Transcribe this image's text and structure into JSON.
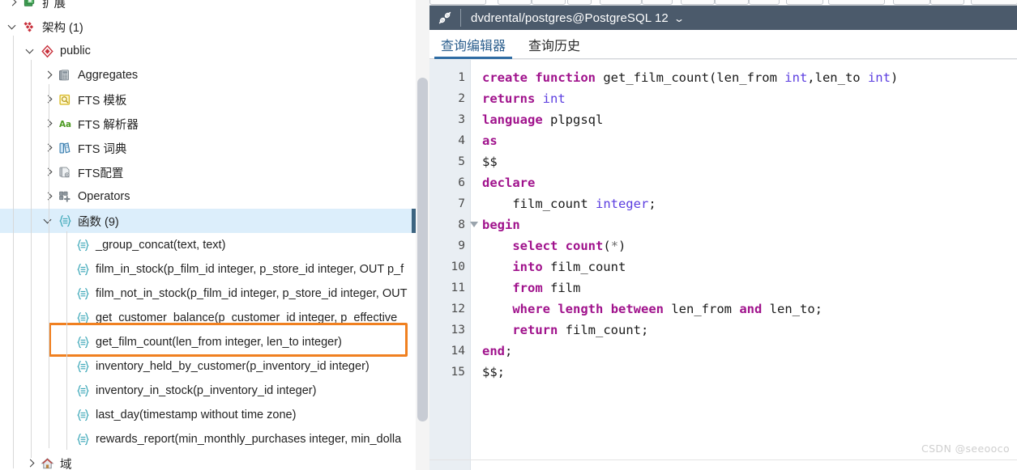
{
  "sidebar": {
    "scrollbar": {
      "name": "vertical-scrollbar"
    },
    "tree": [
      {
        "label": "扩展",
        "icon": "extensions-icon",
        "indent": 0,
        "arrow": "right",
        "selected": false,
        "clipped": true
      },
      {
        "label": "架构 (1)",
        "icon": "schemas-icon",
        "indent": 0,
        "arrow": "down",
        "selected": false
      },
      {
        "label": "public",
        "icon": "schema-icon",
        "indent": 1,
        "arrow": "down",
        "selected": false
      },
      {
        "label": "Aggregates",
        "icon": "aggregates-icon",
        "indent": 2,
        "arrow": "right",
        "selected": false
      },
      {
        "label": "FTS 模板",
        "icon": "fts-template-icon",
        "indent": 2,
        "arrow": "right",
        "selected": false
      },
      {
        "label": "FTS 解析器",
        "icon": "fts-parser-icon",
        "indent": 2,
        "arrow": "right",
        "selected": false
      },
      {
        "label": "FTS 词典",
        "icon": "fts-dictionary-icon",
        "indent": 2,
        "arrow": "right",
        "selected": false
      },
      {
        "label": "FTS配置",
        "icon": "fts-configuration-icon",
        "indent": 2,
        "arrow": "right",
        "selected": false
      },
      {
        "label": "Operators",
        "icon": "operators-icon",
        "indent": 2,
        "arrow": "right",
        "selected": false
      },
      {
        "label": "函数 (9)",
        "icon": "functions-icon",
        "indent": 2,
        "arrow": "down",
        "selected": true
      },
      {
        "label": "_group_concat(text, text)",
        "icon": "function-icon",
        "indent": 3,
        "arrow": "none",
        "selected": false
      },
      {
        "label": "film_in_stock(p_film_id integer, p_store_id integer, OUT p_f",
        "icon": "function-icon",
        "indent": 3,
        "arrow": "none",
        "selected": false
      },
      {
        "label": "film_not_in_stock(p_film_id integer, p_store_id integer, OUT",
        "icon": "function-icon",
        "indent": 3,
        "arrow": "none",
        "selected": false
      },
      {
        "label": "get_customer_balance(p_customer_id integer, p_effective",
        "icon": "function-icon",
        "indent": 3,
        "arrow": "none",
        "selected": false
      },
      {
        "label": "get_film_count(len_from integer, len_to integer)",
        "icon": "function-icon",
        "indent": 3,
        "arrow": "none",
        "selected": false,
        "highlighted": true
      },
      {
        "label": "inventory_held_by_customer(p_inventory_id integer)",
        "icon": "function-icon",
        "indent": 3,
        "arrow": "none",
        "selected": false
      },
      {
        "label": "inventory_in_stock(p_inventory_id integer)",
        "icon": "function-icon",
        "indent": 3,
        "arrow": "none",
        "selected": false
      },
      {
        "label": "last_day(timestamp without time zone)",
        "icon": "function-icon",
        "indent": 3,
        "arrow": "none",
        "selected": false
      },
      {
        "label": "rewards_report(min_monthly_purchases integer, min_dolla",
        "icon": "function-icon",
        "indent": 3,
        "arrow": "none",
        "selected": false
      },
      {
        "label": "域",
        "icon": "domains-icon",
        "indent": 1,
        "arrow": "right",
        "selected": false
      }
    ],
    "highlight_color": "#f08020"
  },
  "query_tool": {
    "connection_title": "dvdrental/postgres@PostgreSQL 12",
    "connection_caret": "⌄",
    "titlebar_icon": "connection-icon",
    "titlebar_color": "#4b5a6b",
    "tabs": [
      {
        "label": "查询编辑器",
        "active": true
      },
      {
        "label": "查询历史",
        "active": false
      }
    ],
    "accent_color": "#2f6ca3",
    "editor": {
      "line_numbers": [
        "1",
        "2",
        "3",
        "4",
        "5",
        "6",
        "7",
        "8",
        "9",
        "10",
        "11",
        "12",
        "13",
        "14",
        "15"
      ],
      "fold_marker_line": 8,
      "lines": [
        {
          "n": 1,
          "tokens": [
            {
              "t": "create",
              "c": "kw"
            },
            {
              "t": " ",
              "c": "pl"
            },
            {
              "t": "function",
              "c": "kw"
            },
            {
              "t": " get_film_count(len_from ",
              "c": "pl"
            },
            {
              "t": "int",
              "c": "ty"
            },
            {
              "t": ",len_to ",
              "c": "pl"
            },
            {
              "t": "int",
              "c": "ty"
            },
            {
              "t": ")",
              "c": "pl"
            }
          ]
        },
        {
          "n": 2,
          "tokens": [
            {
              "t": "returns",
              "c": "kw"
            },
            {
              "t": " ",
              "c": "pl"
            },
            {
              "t": "int",
              "c": "ty"
            }
          ]
        },
        {
          "n": 3,
          "tokens": [
            {
              "t": "language",
              "c": "kw"
            },
            {
              "t": " plpgsql",
              "c": "pl"
            }
          ]
        },
        {
          "n": 4,
          "tokens": [
            {
              "t": "as",
              "c": "kw"
            }
          ]
        },
        {
          "n": 5,
          "tokens": [
            {
              "t": "$$",
              "c": "pl"
            }
          ]
        },
        {
          "n": 6,
          "tokens": [
            {
              "t": "declare",
              "c": "kw"
            }
          ]
        },
        {
          "n": 7,
          "tokens": [
            {
              "t": "    film_count ",
              "c": "pl"
            },
            {
              "t": "integer",
              "c": "ty"
            },
            {
              "t": ";",
              "c": "pl"
            }
          ]
        },
        {
          "n": 8,
          "tokens": [
            {
              "t": "begin",
              "c": "kw"
            }
          ]
        },
        {
          "n": 9,
          "tokens": [
            {
              "t": "    ",
              "c": "pl"
            },
            {
              "t": "select",
              "c": "kw"
            },
            {
              "t": " ",
              "c": "pl"
            },
            {
              "t": "count",
              "c": "kw"
            },
            {
              "t": "(",
              "c": "pl"
            },
            {
              "t": "*",
              "c": "op"
            },
            {
              "t": ")",
              "c": "pl"
            }
          ]
        },
        {
          "n": 10,
          "tokens": [
            {
              "t": "    ",
              "c": "pl"
            },
            {
              "t": "into",
              "c": "kw"
            },
            {
              "t": " film_count",
              "c": "pl"
            }
          ]
        },
        {
          "n": 11,
          "tokens": [
            {
              "t": "    ",
              "c": "pl"
            },
            {
              "t": "from",
              "c": "kw"
            },
            {
              "t": " film",
              "c": "pl"
            }
          ]
        },
        {
          "n": 12,
          "tokens": [
            {
              "t": "    ",
              "c": "pl"
            },
            {
              "t": "where",
              "c": "kw"
            },
            {
              "t": " ",
              "c": "pl"
            },
            {
              "t": "length",
              "c": "kw"
            },
            {
              "t": " ",
              "c": "pl"
            },
            {
              "t": "between",
              "c": "kw"
            },
            {
              "t": " len_from ",
              "c": "pl"
            },
            {
              "t": "and",
              "c": "kw"
            },
            {
              "t": " len_to;",
              "c": "pl"
            }
          ]
        },
        {
          "n": 13,
          "tokens": [
            {
              "t": "    ",
              "c": "pl"
            },
            {
              "t": "return",
              "c": "kw"
            },
            {
              "t": " film_count;",
              "c": "pl"
            }
          ]
        },
        {
          "n": 14,
          "tokens": [
            {
              "t": "end",
              "c": "kw"
            },
            {
              "t": ";",
              "c": "pl"
            }
          ]
        },
        {
          "n": 15,
          "tokens": [
            {
              "t": "$$;",
              "c": "pl"
            }
          ]
        }
      ],
      "keyword_color": "#a0128c",
      "type_color": "#5b3de0",
      "gutter_color": "#e9eef3"
    }
  },
  "watermark": "CSDN @seeooco"
}
